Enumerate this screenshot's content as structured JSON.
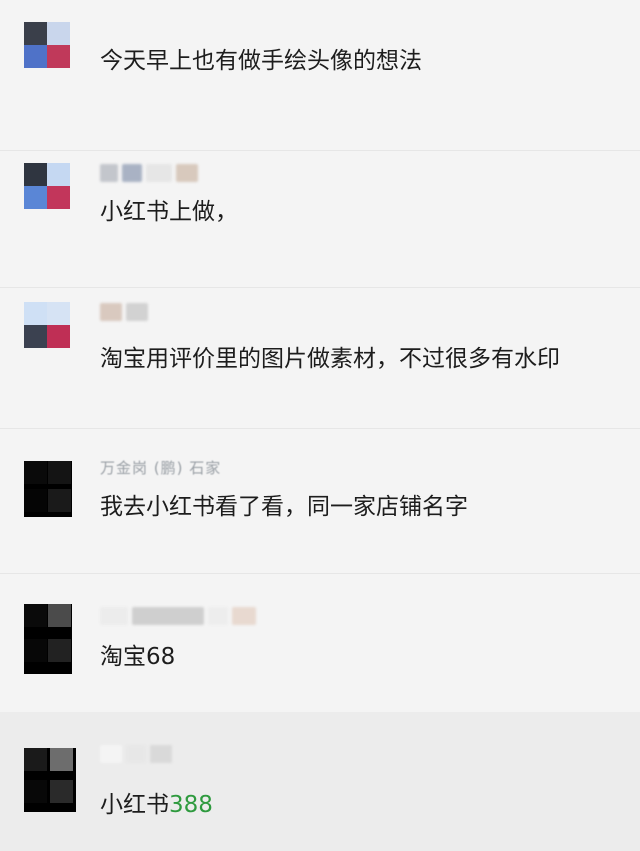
{
  "messages": [
    {
      "name": "",
      "text": "今天早上也有做手绘头像的想法"
    },
    {
      "name": "",
      "text": "小红书上做，"
    },
    {
      "name": "",
      "text": "淘宝用评价里的图片做素材，不过很多有水印"
    },
    {
      "name": "万金岗 (鹏) 石家",
      "text": "我去小红书看了看，同一家店铺名字"
    },
    {
      "name": "",
      "text": "淘宝68"
    },
    {
      "name": "",
      "text_prefix": "小红书",
      "text_number": "388"
    }
  ],
  "colors": {
    "background": "#f4f4f4",
    "highlight_row": "#ececec",
    "price_green": "#2e9a3e"
  }
}
